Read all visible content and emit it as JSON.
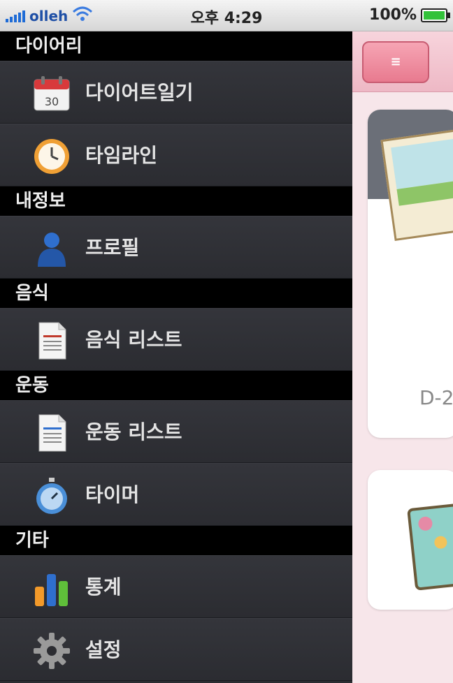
{
  "status_bar": {
    "carrier": "olleh",
    "time": "오후 4:29",
    "battery": "100%"
  },
  "menu": {
    "sections": [
      {
        "title": "다이어리",
        "items": [
          {
            "label": "다이어트일기",
            "icon": "calendar-icon",
            "badge": "30"
          },
          {
            "label": "타임라인",
            "icon": "clock-icon"
          }
        ]
      },
      {
        "title": "내정보",
        "items": [
          {
            "label": "프로필",
            "icon": "person-icon"
          }
        ]
      },
      {
        "title": "음식",
        "items": [
          {
            "label": "음식 리스트",
            "icon": "document-icon"
          }
        ]
      },
      {
        "title": "운동",
        "items": [
          {
            "label": "운동 리스트",
            "icon": "document-icon"
          },
          {
            "label": "타이머",
            "icon": "stopwatch-icon"
          }
        ]
      },
      {
        "title": "기타",
        "items": [
          {
            "label": "통계",
            "icon": "bar-chart-icon"
          },
          {
            "label": "설정",
            "icon": "gear-icon"
          }
        ]
      }
    ]
  },
  "content": {
    "top_button_label": "≡",
    "dday_label": "D-2"
  },
  "colors": {
    "menu_bg": "#2c2d32",
    "section_header_bg": "#000000",
    "accent_pink": "#e87a8f"
  }
}
